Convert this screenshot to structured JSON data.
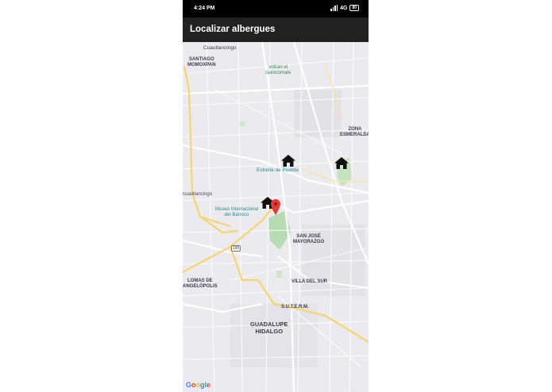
{
  "status_bar": {
    "time": "4:24 PM",
    "network": "4G",
    "battery": "80"
  },
  "app_bar": {
    "title": "Localizar albergues"
  },
  "map": {
    "labels": {
      "cuautlancingo": "Cuautlancingo",
      "santiago": "SANTIAGO\nMOMOXPAN",
      "volcan": "volcan el\ncuexcomate",
      "zona_esmeralda": "ZONA\nESMERALDA",
      "estrella": "Estrella de Puebla",
      "cuautlancingo_left": "cuautlancingo",
      "museo": "Museo Internacional\ndel Barroco",
      "san_jose": "SAN JOSÉ\nMAYORAZGO",
      "villa_del_sur": "VILLA DEL SUR",
      "lomas": "LOMAS DE\nANGELÓPOLIS",
      "sutem": "S.U.T.E.R.M.",
      "guadalupe": "GUADALUPE\nHIDALGO",
      "route": "190"
    },
    "markers": {
      "house_icon": "house-icon",
      "pin_icon": "location-pin-icon",
      "pin_color": "#e53935"
    },
    "attribution": "Google"
  }
}
